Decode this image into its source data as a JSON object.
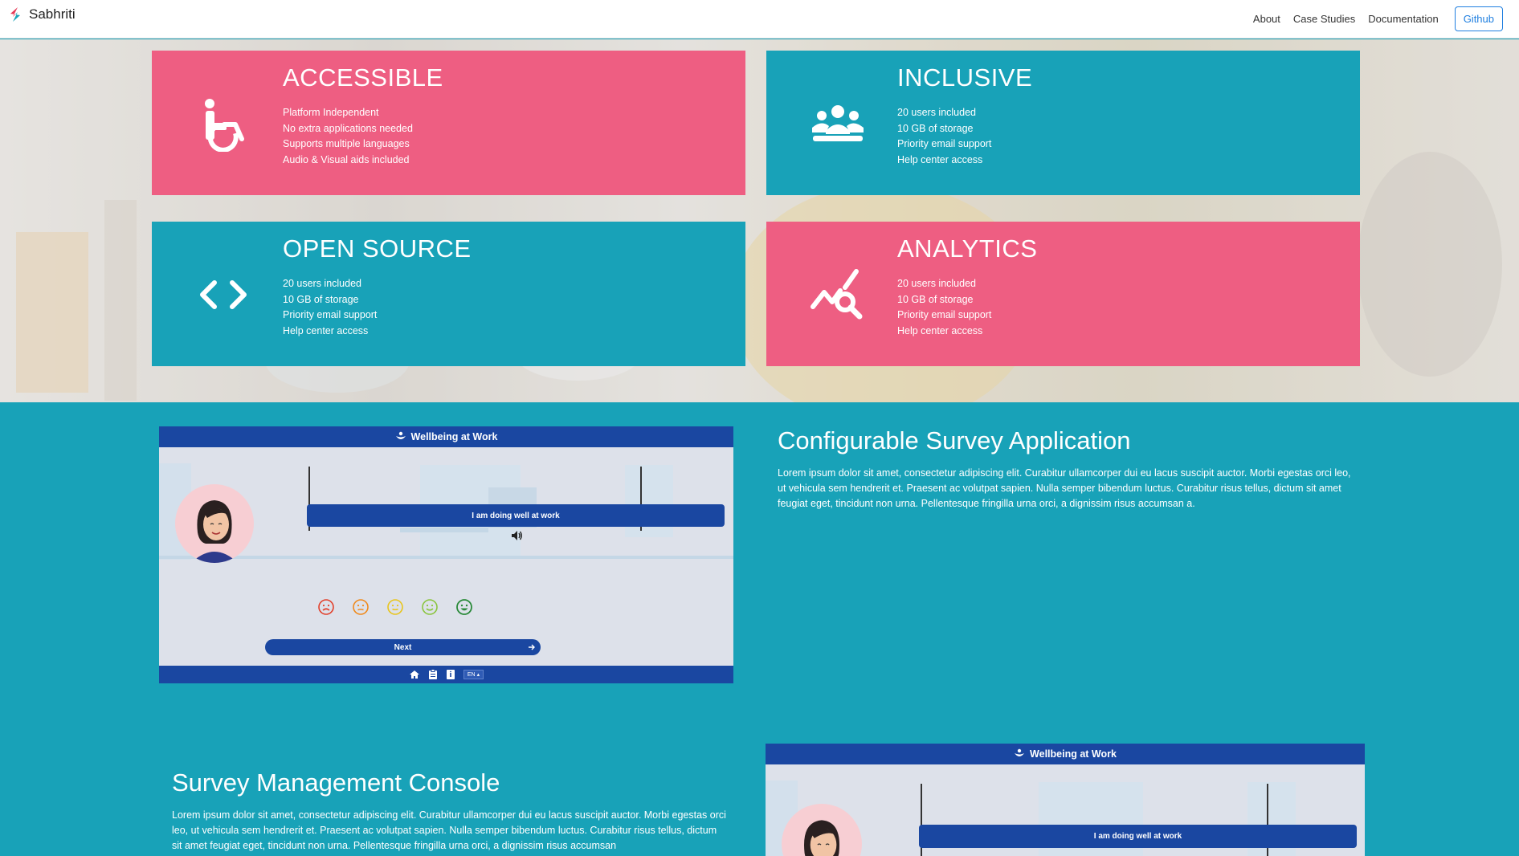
{
  "nav": {
    "brand": "Sabhriti",
    "links": [
      "About",
      "Case Studies",
      "Documentation"
    ],
    "github": "Github"
  },
  "cards": [
    {
      "title": "ACCESSIBLE",
      "icon": "wheelchair-icon",
      "color": "#ee5e82",
      "items": [
        "Platform Independent",
        "No extra applications needed",
        "Supports multiple languages",
        "Audio & Visual aids included"
      ]
    },
    {
      "title": "INCLUSIVE",
      "icon": "users-group-icon",
      "color": "#18a2b8",
      "items": [
        "20 users included",
        "10 GB of storage",
        "Priority email support",
        "Help center access"
      ]
    },
    {
      "title": "OPEN SOURCE",
      "icon": "code-icon",
      "color": "#18a2b8",
      "items": [
        "20 users included",
        "10 GB of storage",
        "Priority email support",
        "Help center access"
      ]
    },
    {
      "title": "ANALYTICS",
      "icon": "analytics-search-icon",
      "color": "#ee5e82",
      "items": [
        "20 users included",
        "10 GB of storage",
        "Priority email support",
        "Help center access"
      ]
    }
  ],
  "features": [
    {
      "title": "Configurable Survey Application",
      "desc": "Lorem ipsum dolor sit amet, consectetur adipiscing elit. Curabitur ullamcorper dui eu lacus suscipit auctor. Morbi egestas orci leo, ut vehicula sem hendrerit et. Praesent ac volutpat sapien. Nulla semper bibendum luctus. Curabitur risus tellus, dictum sit amet feugiat eget, tincidunt non urna. Pellentesque fringilla urna orci, a dignissim risus accumsan a."
    },
    {
      "title": "Survey Management Console",
      "desc": "Lorem ipsum dolor sit amet, consectetur adipiscing elit. Curabitur ullamcorper dui eu lacus suscipit auctor. Morbi egestas orci leo, ut vehicula sem hendrerit et. Praesent ac volutpat sapien. Nulla semper bibendum luctus. Curabitur risus tellus, dictum sit amet feugiat eget, tincidunt non urna. Pellentesque fringilla urna orci, a dignissim risus accumsan"
    }
  ],
  "mockup": {
    "app_title": "Wellbeing at Work",
    "statement": "I am doing well at work",
    "next": "Next",
    "lang": "EN",
    "mood_colors": [
      "#e2412c",
      "#f08a1c",
      "#e8c51e",
      "#8bc53f",
      "#2a8a3a"
    ]
  }
}
